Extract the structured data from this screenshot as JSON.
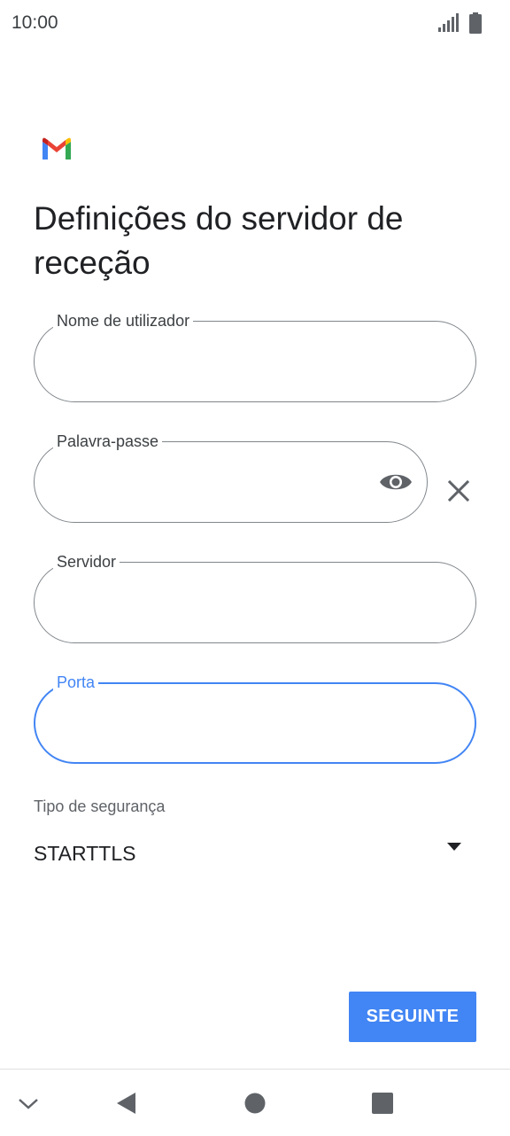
{
  "status_bar": {
    "time": "10:00",
    "signal_icon": "cellular-signal-icon",
    "battery_icon": "battery-icon"
  },
  "app": {
    "logo_icon": "gmail-logo"
  },
  "page": {
    "title": "Definições do servidor de receção"
  },
  "form": {
    "username": {
      "label": "Nome de utilizador",
      "value": ""
    },
    "password": {
      "label": "Palavra-passe",
      "value": "",
      "toggle_icon": "eye-icon",
      "clear_icon": "close-icon"
    },
    "server": {
      "label": "Servidor",
      "value": ""
    },
    "port": {
      "label": "Porta",
      "value": ""
    },
    "security": {
      "label": "Tipo de segurança",
      "value": "STARTTLS",
      "dropdown_icon": "triangle-down-icon"
    }
  },
  "actions": {
    "next_label": "SEGUINTE"
  },
  "nav_bar": {
    "icons": [
      "chevron-down-icon",
      "back-triangle-icon",
      "home-circle-icon",
      "recents-square-icon"
    ]
  },
  "colors": {
    "accent": "#4285f4",
    "outline": "#80868b",
    "text": "#202124"
  }
}
